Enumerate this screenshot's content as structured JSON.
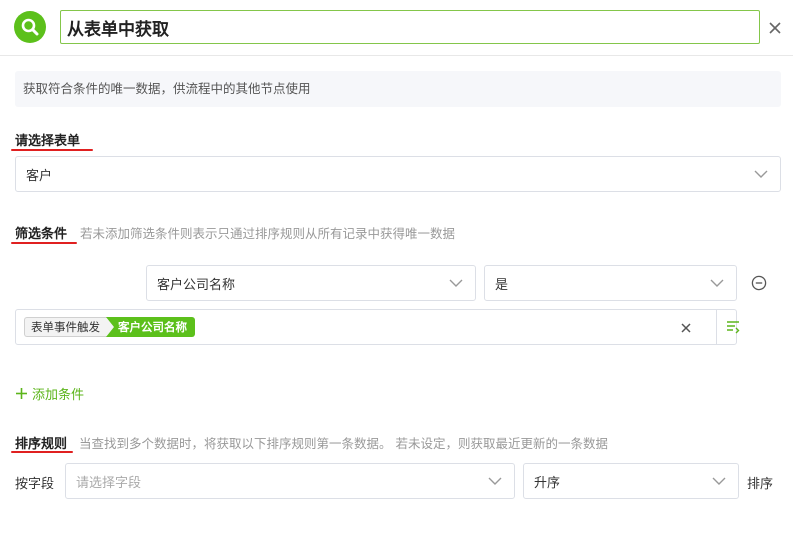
{
  "header": {
    "title_value": "从表单中获取"
  },
  "description": "获取符合条件的唯一数据，供流程中的其他节点使用",
  "form_section": {
    "title": "请选择表单",
    "selected": "客户"
  },
  "filter_section": {
    "title": "筛选条件",
    "hint": "若未添加筛选条件则表示只通过排序规则从所有记录中获得唯一数据",
    "condition": {
      "field": "客户公司名称",
      "operator": "是",
      "value_source": "表单事件触发",
      "value_field": "客户公司名称"
    },
    "add_label": "添加条件"
  },
  "sort_section": {
    "title": "排序规则",
    "hint": "当查找到多个数据时，将获取以下排序规则第一条数据。 若未设定，则获取最近更新的一条数据",
    "by_field_label": "按字段",
    "field_placeholder": "请选择字段",
    "order": "升序",
    "sort_label": "排序"
  },
  "colors": {
    "accent": "#5cc01b",
    "underline": "#e02020"
  }
}
